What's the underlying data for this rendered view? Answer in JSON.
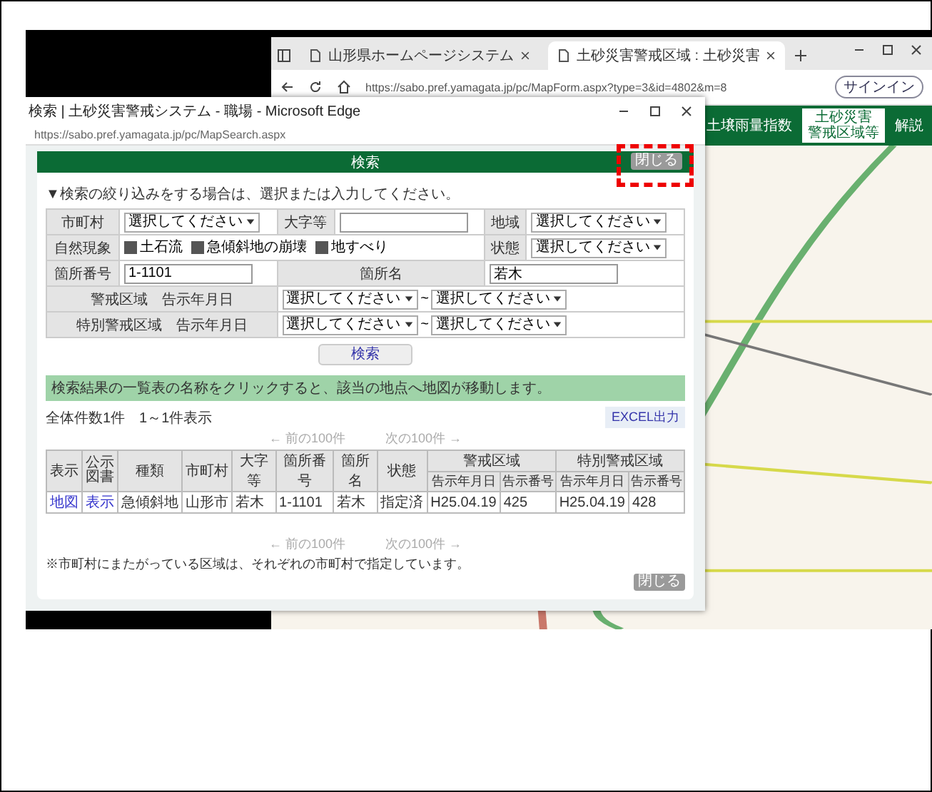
{
  "browser": {
    "tabs": [
      {
        "label": "山形県ホームページシステム",
        "selected": false
      },
      {
        "label": "土砂災害警戒区域 : 土砂災害",
        "selected": true
      }
    ],
    "url": "https://sabo.pref.yamagata.jp/pc/MapForm.aspx?type=3&id=4802&m=8",
    "signin": "サインイン",
    "nav": [
      {
        "label": "土壌雨量指数",
        "selected": false
      },
      {
        "lines": [
          "土砂災害",
          "警戒区域等"
        ],
        "selected": true
      },
      {
        "label": "解説",
        "selected": false
      }
    ]
  },
  "popup": {
    "title": "検索 | 土砂災害警戒システム - 職場 - Microsoft Edge",
    "url": "https://sabo.pref.yamagata.jp/pc/MapSearch.aspx",
    "header": "検索",
    "close_top": {
      "label": "閉じる",
      "highlighted": true
    },
    "instruction": "▼検索の絞り込みをする場合は、選択または入力してください。",
    "form": [
      {
        "kind": "triple",
        "fields": [
          {
            "label": "市町村",
            "kind": "select",
            "value": "選択してください"
          },
          {
            "label": "大字等",
            "kind": "input"
          },
          {
            "label": "地域",
            "kind": "select",
            "value": "選択してください"
          }
        ]
      },
      {
        "kind": "checks",
        "label": "自然現象",
        "options": [
          {
            "label": "土石流",
            "checked": true
          },
          {
            "label": "急傾斜地の崩壊",
            "checked": true
          },
          {
            "label": "地すべり",
            "checked": true
          }
        ],
        "side": {
          "label": "状態",
          "kind": "select",
          "value": "選択してください"
        }
      },
      {
        "kind": "pair",
        "fields": [
          {
            "label": "箇所番号",
            "kind": "input",
            "value": "1-1101"
          },
          {
            "label": "箇所名",
            "kind": "input",
            "value": "若木"
          }
        ]
      },
      {
        "kind": "range",
        "label": "警戒区域　告示年月日",
        "from": "選択してください",
        "separator": "~",
        "to": "選択してください"
      },
      {
        "kind": "range",
        "label": "特別警戒区域　告示年月日",
        "from": "選択してください",
        "separator": "~",
        "to": "選択してください"
      }
    ],
    "search_button": "検索",
    "info": "検索結果の一覧表の名称をクリックすると、該当の地点へ地図が移動します。",
    "count": "全体件数1件　1～1件表示",
    "excel_button": "EXCEL出力",
    "pager_top": [
      {
        "label": "← 前の100件",
        "disabled": true
      },
      {
        "label": "次の100件 →",
        "disabled": true
      }
    ],
    "table": {
      "columns": [
        {
          "label": "表示"
        },
        {
          "label": "公示図書"
        },
        {
          "label": "種類"
        },
        {
          "label": "市町村"
        },
        {
          "label": "大字等"
        },
        {
          "label": "箇所番号"
        },
        {
          "label": "箇所名"
        },
        {
          "label": "状態"
        }
      ],
      "groups": [
        {
          "label": "警戒区域",
          "columns": [
            {
              "label": "告示年月日"
            },
            {
              "label": "告示番号"
            }
          ]
        },
        {
          "label": "特別警戒区域",
          "columns": [
            {
              "label": "告示年月日"
            },
            {
              "label": "告示番号"
            }
          ]
        }
      ],
      "rows": [
        {
          "cells": [
            {
              "text": "地図",
              "link": true
            },
            {
              "text": "表示",
              "link": true
            },
            {
              "text": "急傾斜地",
              "link": false
            },
            {
              "text": "山形市",
              "link": false
            },
            {
              "text": "若木",
              "link": false
            },
            {
              "text": "1-1101",
              "link": false
            },
            {
              "text": "若木",
              "link": false
            },
            {
              "text": "指定済",
              "link": false
            },
            {
              "text": "H25.04.19",
              "link": false
            },
            {
              "text": "425",
              "link": false
            },
            {
              "text": "H25.04.19",
              "link": false
            },
            {
              "text": "428",
              "link": false
            }
          ]
        }
      ]
    },
    "pager_bottom": [
      {
        "label": "← 前の100件",
        "disabled": true
      },
      {
        "label": "次の100件 →",
        "disabled": true
      }
    ],
    "note": "※市町村にまたがっている区域は、それぞれの市町村で指定しています。",
    "close_bottom": {
      "label": "閉じる",
      "highlighted": false
    }
  }
}
